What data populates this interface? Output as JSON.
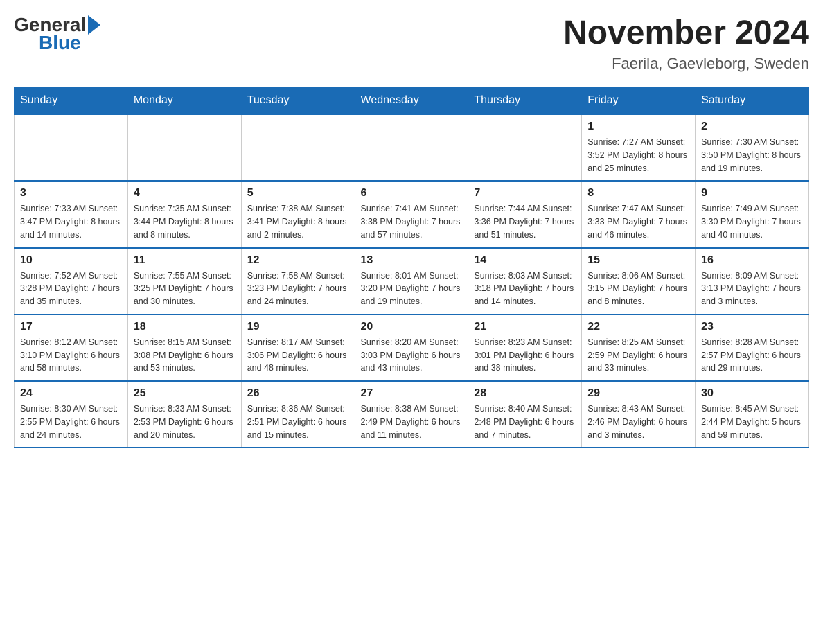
{
  "header": {
    "logo": {
      "general_text": "General",
      "blue_text": "Blue"
    },
    "title": "November 2024",
    "location": "Faerila, Gaevleborg, Sweden"
  },
  "weekdays": [
    "Sunday",
    "Monday",
    "Tuesday",
    "Wednesday",
    "Thursday",
    "Friday",
    "Saturday"
  ],
  "weeks": [
    {
      "days": [
        {
          "number": "",
          "info": ""
        },
        {
          "number": "",
          "info": ""
        },
        {
          "number": "",
          "info": ""
        },
        {
          "number": "",
          "info": ""
        },
        {
          "number": "",
          "info": ""
        },
        {
          "number": "1",
          "info": "Sunrise: 7:27 AM\nSunset: 3:52 PM\nDaylight: 8 hours\nand 25 minutes."
        },
        {
          "number": "2",
          "info": "Sunrise: 7:30 AM\nSunset: 3:50 PM\nDaylight: 8 hours\nand 19 minutes."
        }
      ]
    },
    {
      "days": [
        {
          "number": "3",
          "info": "Sunrise: 7:33 AM\nSunset: 3:47 PM\nDaylight: 8 hours\nand 14 minutes."
        },
        {
          "number": "4",
          "info": "Sunrise: 7:35 AM\nSunset: 3:44 PM\nDaylight: 8 hours\nand 8 minutes."
        },
        {
          "number": "5",
          "info": "Sunrise: 7:38 AM\nSunset: 3:41 PM\nDaylight: 8 hours\nand 2 minutes."
        },
        {
          "number": "6",
          "info": "Sunrise: 7:41 AM\nSunset: 3:38 PM\nDaylight: 7 hours\nand 57 minutes."
        },
        {
          "number": "7",
          "info": "Sunrise: 7:44 AM\nSunset: 3:36 PM\nDaylight: 7 hours\nand 51 minutes."
        },
        {
          "number": "8",
          "info": "Sunrise: 7:47 AM\nSunset: 3:33 PM\nDaylight: 7 hours\nand 46 minutes."
        },
        {
          "number": "9",
          "info": "Sunrise: 7:49 AM\nSunset: 3:30 PM\nDaylight: 7 hours\nand 40 minutes."
        }
      ]
    },
    {
      "days": [
        {
          "number": "10",
          "info": "Sunrise: 7:52 AM\nSunset: 3:28 PM\nDaylight: 7 hours\nand 35 minutes."
        },
        {
          "number": "11",
          "info": "Sunrise: 7:55 AM\nSunset: 3:25 PM\nDaylight: 7 hours\nand 30 minutes."
        },
        {
          "number": "12",
          "info": "Sunrise: 7:58 AM\nSunset: 3:23 PM\nDaylight: 7 hours\nand 24 minutes."
        },
        {
          "number": "13",
          "info": "Sunrise: 8:01 AM\nSunset: 3:20 PM\nDaylight: 7 hours\nand 19 minutes."
        },
        {
          "number": "14",
          "info": "Sunrise: 8:03 AM\nSunset: 3:18 PM\nDaylight: 7 hours\nand 14 minutes."
        },
        {
          "number": "15",
          "info": "Sunrise: 8:06 AM\nSunset: 3:15 PM\nDaylight: 7 hours\nand 8 minutes."
        },
        {
          "number": "16",
          "info": "Sunrise: 8:09 AM\nSunset: 3:13 PM\nDaylight: 7 hours\nand 3 minutes."
        }
      ]
    },
    {
      "days": [
        {
          "number": "17",
          "info": "Sunrise: 8:12 AM\nSunset: 3:10 PM\nDaylight: 6 hours\nand 58 minutes."
        },
        {
          "number": "18",
          "info": "Sunrise: 8:15 AM\nSunset: 3:08 PM\nDaylight: 6 hours\nand 53 minutes."
        },
        {
          "number": "19",
          "info": "Sunrise: 8:17 AM\nSunset: 3:06 PM\nDaylight: 6 hours\nand 48 minutes."
        },
        {
          "number": "20",
          "info": "Sunrise: 8:20 AM\nSunset: 3:03 PM\nDaylight: 6 hours\nand 43 minutes."
        },
        {
          "number": "21",
          "info": "Sunrise: 8:23 AM\nSunset: 3:01 PM\nDaylight: 6 hours\nand 38 minutes."
        },
        {
          "number": "22",
          "info": "Sunrise: 8:25 AM\nSunset: 2:59 PM\nDaylight: 6 hours\nand 33 minutes."
        },
        {
          "number": "23",
          "info": "Sunrise: 8:28 AM\nSunset: 2:57 PM\nDaylight: 6 hours\nand 29 minutes."
        }
      ]
    },
    {
      "days": [
        {
          "number": "24",
          "info": "Sunrise: 8:30 AM\nSunset: 2:55 PM\nDaylight: 6 hours\nand 24 minutes."
        },
        {
          "number": "25",
          "info": "Sunrise: 8:33 AM\nSunset: 2:53 PM\nDaylight: 6 hours\nand 20 minutes."
        },
        {
          "number": "26",
          "info": "Sunrise: 8:36 AM\nSunset: 2:51 PM\nDaylight: 6 hours\nand 15 minutes."
        },
        {
          "number": "27",
          "info": "Sunrise: 8:38 AM\nSunset: 2:49 PM\nDaylight: 6 hours\nand 11 minutes."
        },
        {
          "number": "28",
          "info": "Sunrise: 8:40 AM\nSunset: 2:48 PM\nDaylight: 6 hours\nand 7 minutes."
        },
        {
          "number": "29",
          "info": "Sunrise: 8:43 AM\nSunset: 2:46 PM\nDaylight: 6 hours\nand 3 minutes."
        },
        {
          "number": "30",
          "info": "Sunrise: 8:45 AM\nSunset: 2:44 PM\nDaylight: 5 hours\nand 59 minutes."
        }
      ]
    }
  ]
}
